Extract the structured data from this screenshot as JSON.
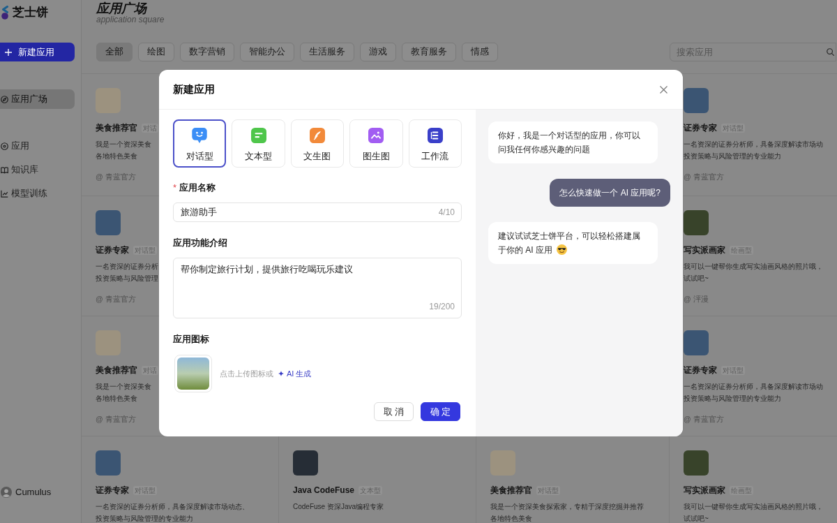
{
  "sidebar": {
    "logo": "芝士饼",
    "new_app_button": "新建应用",
    "items": [
      {
        "label": "应用广场",
        "selected": true
      },
      {
        "label": "应用",
        "selected": false
      },
      {
        "label": "知识库",
        "selected": false
      },
      {
        "label": "模型训练",
        "selected": false
      }
    ],
    "user": "Cumulus"
  },
  "header": {
    "title": "应用广场",
    "subtitle": "application square"
  },
  "categories": [
    {
      "label": "全部",
      "selected": true
    },
    {
      "label": "绘图",
      "selected": false
    },
    {
      "label": "数字营销",
      "selected": false
    },
    {
      "label": "智能办公",
      "selected": false
    },
    {
      "label": "生活服务",
      "selected": false
    },
    {
      "label": "游戏",
      "selected": false
    },
    {
      "label": "教育服务",
      "selected": false
    },
    {
      "label": "情感",
      "selected": false
    }
  ],
  "search": {
    "placeholder": "搜索应用"
  },
  "card_columns": [
    {
      "cards": [
        {
          "title": "美食推荐官",
          "tag": "对话",
          "desc": [
            "我是一个资深美食",
            "各地特色美食"
          ],
          "author": "@ 青蓝官方",
          "color": "#9c927f"
        },
        {
          "title": "证券专家",
          "tag": "对话型",
          "desc": [
            "一名资深的证券分析",
            "投资策略与风险管理"
          ],
          "author": "@ 青蓝官方",
          "color": "#3b5573"
        },
        {
          "title": "美食推荐官",
          "tag": "对话",
          "desc": [
            "我是一个资深美食",
            "各地特色美食"
          ],
          "author": "@ 青蓝官方",
          "color": "#9c927f"
        },
        {
          "title": "证券专家",
          "tag": "对话型",
          "desc": [
            "一名资深的证券分析师，具备深度解读市场动态、",
            "投资策略与风险管理的专业能力"
          ],
          "color": "#3b5573"
        }
      ]
    },
    {
      "cards": [
        {
          "title": "Java CodeFuse",
          "tag": "文本型",
          "desc": [
            "CodeFuse 资深Java编程专家"
          ],
          "color": "#262d36"
        }
      ]
    },
    {
      "cards": [
        {
          "title": "美食推荐官",
          "tag": "对话型",
          "desc": [
            "我是一个资深美食探索家，专精于深度挖掘并推荐",
            "各地特色美食"
          ],
          "color": "#9c927f"
        }
      ]
    },
    {
      "cards": [
        {
          "title": "证券专家",
          "tag": "对话型",
          "desc": [
            "一名资深的证券分析师，具备深度解读市场动",
            "投资策略与风险管理的专业能力"
          ],
          "author": "@ 青蓝官方",
          "color": "#3b5573"
        },
        {
          "title": "写实派画家",
          "tag": "绘画型",
          "desc": [
            "我可以一键帮你生成写实油画风格的照片哦，",
            "试试吧~"
          ],
          "author": "@ 泙漫",
          "color": "#38432a"
        },
        {
          "title": "证券专家",
          "tag": "对话型",
          "desc": [
            "一名资深的证券分析师，具备深度解读市场动",
            "投资策略与风险管理的专业能力"
          ],
          "author": "@ 青蓝官方",
          "color": "#3b5573"
        },
        {
          "title": "写实派画家",
          "tag": "绘画型",
          "desc": [
            "我可以一键帮你生成写实油画风格的照片哦，",
            "试试吧~"
          ],
          "color": "#38432a"
        }
      ]
    }
  ],
  "modal": {
    "title": "新建应用",
    "types": [
      {
        "label": "对话型",
        "kind": "chat",
        "selected": true
      },
      {
        "label": "文本型",
        "kind": "text",
        "selected": false
      },
      {
        "label": "文生图",
        "kind": "text_image",
        "selected": false
      },
      {
        "label": "图生图",
        "kind": "image_image",
        "selected": false
      },
      {
        "label": "工作流",
        "kind": "workflow",
        "selected": false
      }
    ],
    "name_field": {
      "required_mark": "*",
      "label": "应用名称",
      "value": "旅游助手",
      "counter": "4/10"
    },
    "description_field": {
      "label": "应用功能介绍",
      "value": "帮你制定旅行计划，提供旅行吃喝玩乐建议",
      "counter": "19/200"
    },
    "icon_field": {
      "label": "应用图标",
      "hint": "点击上传图标或",
      "ai_link": "AI 生成"
    },
    "buttons": [
      {
        "label": "取 消",
        "kind": "secondary"
      },
      {
        "label": "确 定",
        "kind": "primary"
      }
    ],
    "chat": [
      {
        "kind": "assistant",
        "text": "你好，我是一个对话型的应用，你可以问我任何你感兴趣的问题",
        "emoji": false
      },
      {
        "kind": "user",
        "text": "怎么快速做一个 AI 应用呢?",
        "emoji": false
      },
      {
        "kind": "assistant",
        "text": "建议试试芝士饼平台，可以轻松搭建属于你的 AI 应用",
        "emoji": true
      }
    ]
  }
}
